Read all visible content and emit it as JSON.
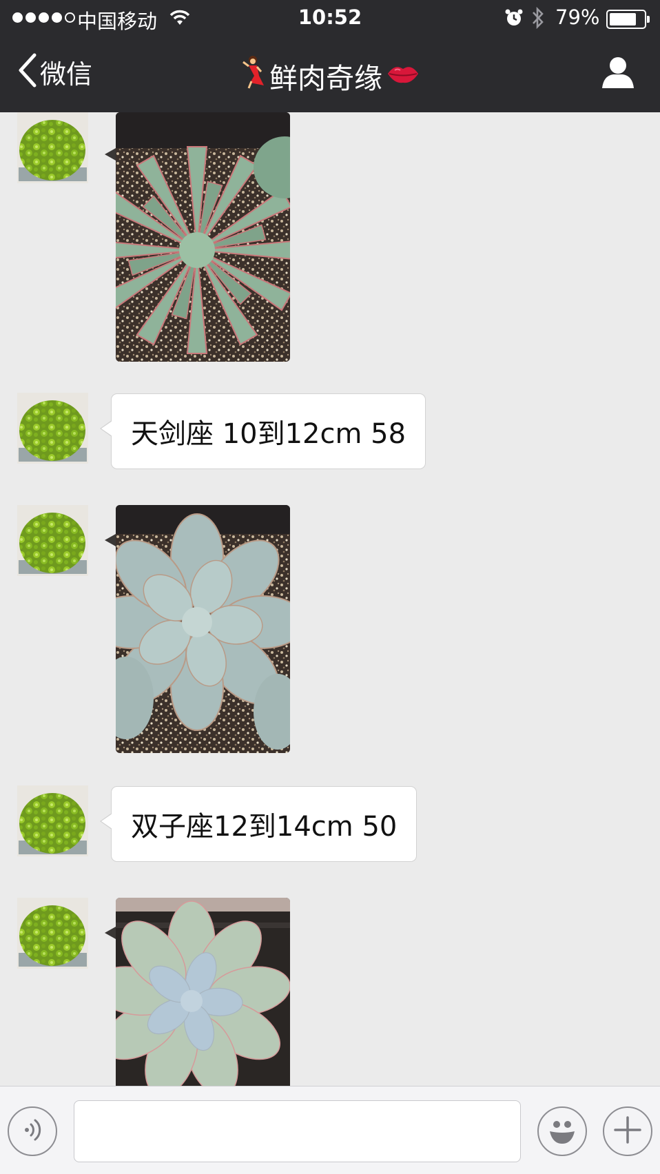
{
  "status_bar": {
    "carrier": "中国移动",
    "time": "10:52",
    "battery_text": "79%",
    "battery_level": 0.79,
    "signal_bars_filled": 4,
    "signal_bars_total": 5
  },
  "nav": {
    "back_label": "微信",
    "title": "鲜肉奇缘",
    "title_leading_emoji": "dancer-emoji",
    "title_trailing_emoji": "lips-emoji",
    "profile_icon": "person-icon"
  },
  "messages": [
    {
      "type": "image",
      "sender_avatar": "succulent-avatar",
      "image": "echeveria-green-pink-edge-photo"
    },
    {
      "type": "text",
      "sender_avatar": "succulent-avatar",
      "text": "天剑座 10到12cm 58"
    },
    {
      "type": "image",
      "sender_avatar": "succulent-avatar",
      "image": "echeveria-blue-grey-photo"
    },
    {
      "type": "text",
      "sender_avatar": "succulent-avatar",
      "text": "双子座12到14cm 50"
    },
    {
      "type": "image",
      "sender_avatar": "succulent-avatar",
      "image": "echeveria-pale-blue-photo"
    }
  ],
  "input_bar": {
    "voice_icon": "voice-icon",
    "input_value": "",
    "emoji_icon": "smiley-icon",
    "add_icon": "plus-icon"
  },
  "colors": {
    "header_bg": "#2b2b2e",
    "chat_bg": "#ebebeb",
    "bubble_bg": "#ffffff",
    "input_bar_bg": "#f4f4f6"
  }
}
